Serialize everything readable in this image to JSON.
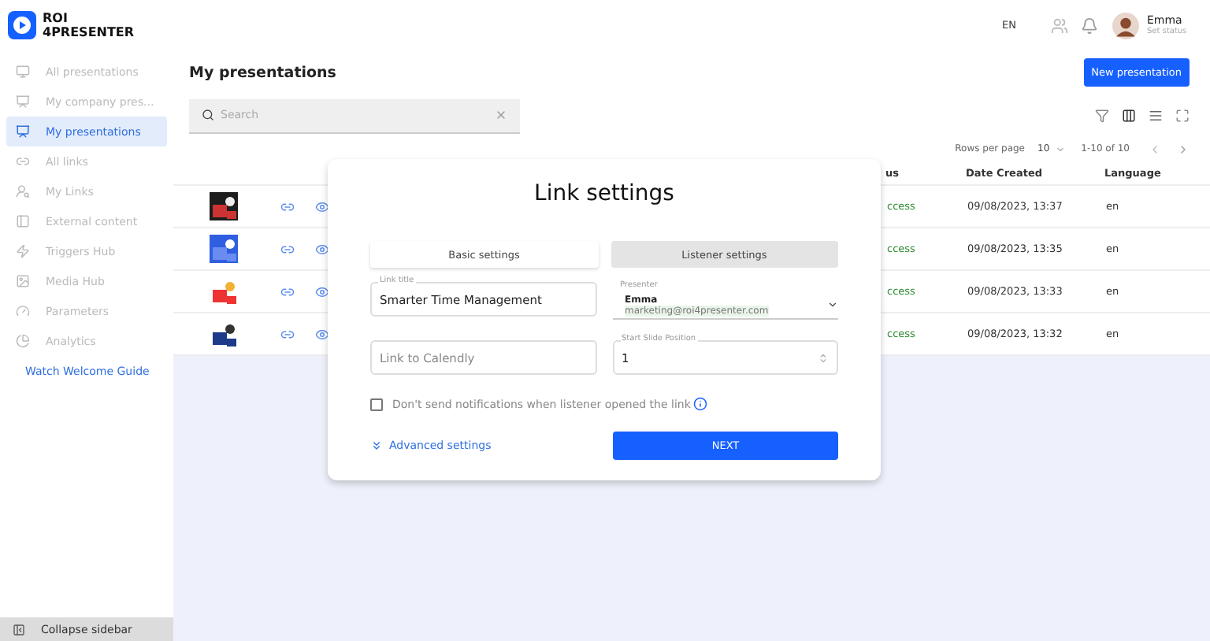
{
  "logo": {
    "line1": "ROI",
    "line2": "4PRESENTER"
  },
  "header": {
    "language": "EN",
    "user": {
      "name": "Emma",
      "status": "Set status"
    }
  },
  "sidebar": {
    "items": [
      {
        "label": "All presentations",
        "selected": false
      },
      {
        "label": "My company pres...",
        "selected": false
      },
      {
        "label": "My presentations",
        "selected": true
      },
      {
        "label": "All links",
        "selected": false
      },
      {
        "label": "My Links",
        "selected": false
      },
      {
        "label": "External content",
        "selected": false
      },
      {
        "label": "Triggers Hub",
        "selected": false
      },
      {
        "label": "Media Hub",
        "selected": false
      },
      {
        "label": "Parameters",
        "selected": false
      },
      {
        "label": "Analytics",
        "selected": false
      }
    ],
    "guide_link": "Watch Welcome Guide",
    "collapse": "Collapse sidebar"
  },
  "page": {
    "title": "My presentations",
    "new_button": "New presentation",
    "search": {
      "placeholder": "Search"
    }
  },
  "pagination": {
    "rows_per_page_label": "Rows per page",
    "rows_per_page": "10",
    "range": "1-10 of 10"
  },
  "table": {
    "columns": [
      "us",
      "Date Created",
      "Language"
    ],
    "rows": [
      {
        "status": "ccess",
        "date": "09/08/2023, 13:37",
        "language": "en"
      },
      {
        "status": "ccess",
        "date": "09/08/2023, 13:35",
        "language": "en"
      },
      {
        "status": "ccess",
        "date": "09/08/2023, 13:33",
        "language": "en"
      },
      {
        "status": "ccess",
        "date": "09/08/2023, 13:32",
        "language": "en"
      }
    ]
  },
  "dialog": {
    "title": "Link settings",
    "tabs": [
      {
        "label": "Basic settings",
        "selected": true
      },
      {
        "label": "Listener settings",
        "selected": false
      }
    ],
    "link_title": {
      "label": "Link title",
      "value": "Smarter Time Management"
    },
    "presenter": {
      "label": "Presenter",
      "name": "Emma",
      "email": "marketing@roi4presenter.com"
    },
    "calendly": {
      "placeholder": "Link to Calendly"
    },
    "start_slide": {
      "label": "Start Slide Position",
      "value": "1"
    },
    "notify": {
      "label": "Don't send notifications when listener opened the link",
      "checked": false
    },
    "advanced": "Advanced settings",
    "next": "NEXT"
  }
}
